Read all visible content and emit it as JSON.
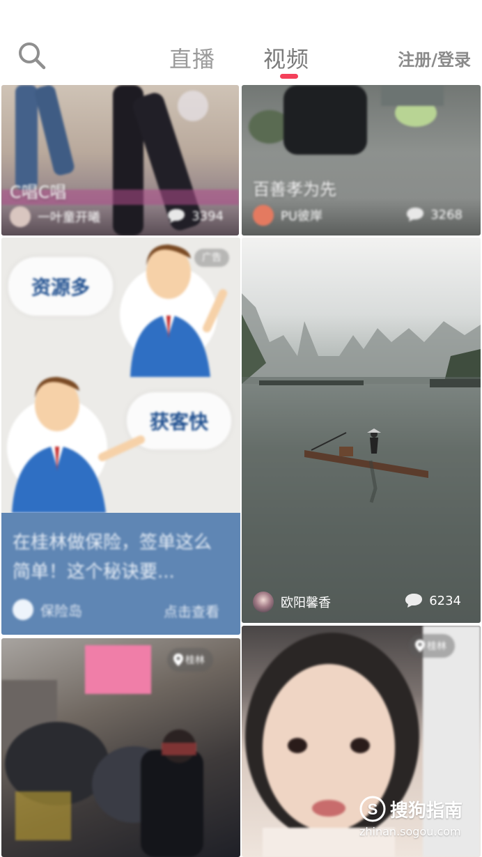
{
  "header": {
    "tabs": [
      {
        "label": "直播",
        "active": false
      },
      {
        "label": "视频",
        "active": true
      }
    ],
    "login_label": "注册/登录",
    "accent_color": "#f4405a"
  },
  "feed": [
    {
      "id": "card-a",
      "title": "C唱C唱",
      "author": "一叶童开曦",
      "comments": "3394"
    },
    {
      "id": "card-b",
      "title": "百善孝为先",
      "author": "PU彼岸",
      "comments": "3268"
    },
    {
      "id": "card-c",
      "type": "ad",
      "bubble_left": "资源多",
      "bubble_right": "获客快",
      "badge": "广告",
      "title": "在桂林做保险，签单这么简单！这个秘诀要...",
      "source": "保险岛",
      "cta": "点击查看"
    },
    {
      "id": "card-d",
      "author": "欧阳馨香",
      "comments": "6234"
    },
    {
      "id": "card-e",
      "location": "桂林"
    },
    {
      "id": "card-f",
      "location": "桂林"
    }
  ],
  "watermark": {
    "brand": "搜狗指南",
    "url": "zhinan.sogou.com"
  },
  "icons": [
    "search-icon",
    "comment-icon",
    "location-icon",
    "sogou-logo-icon"
  ]
}
